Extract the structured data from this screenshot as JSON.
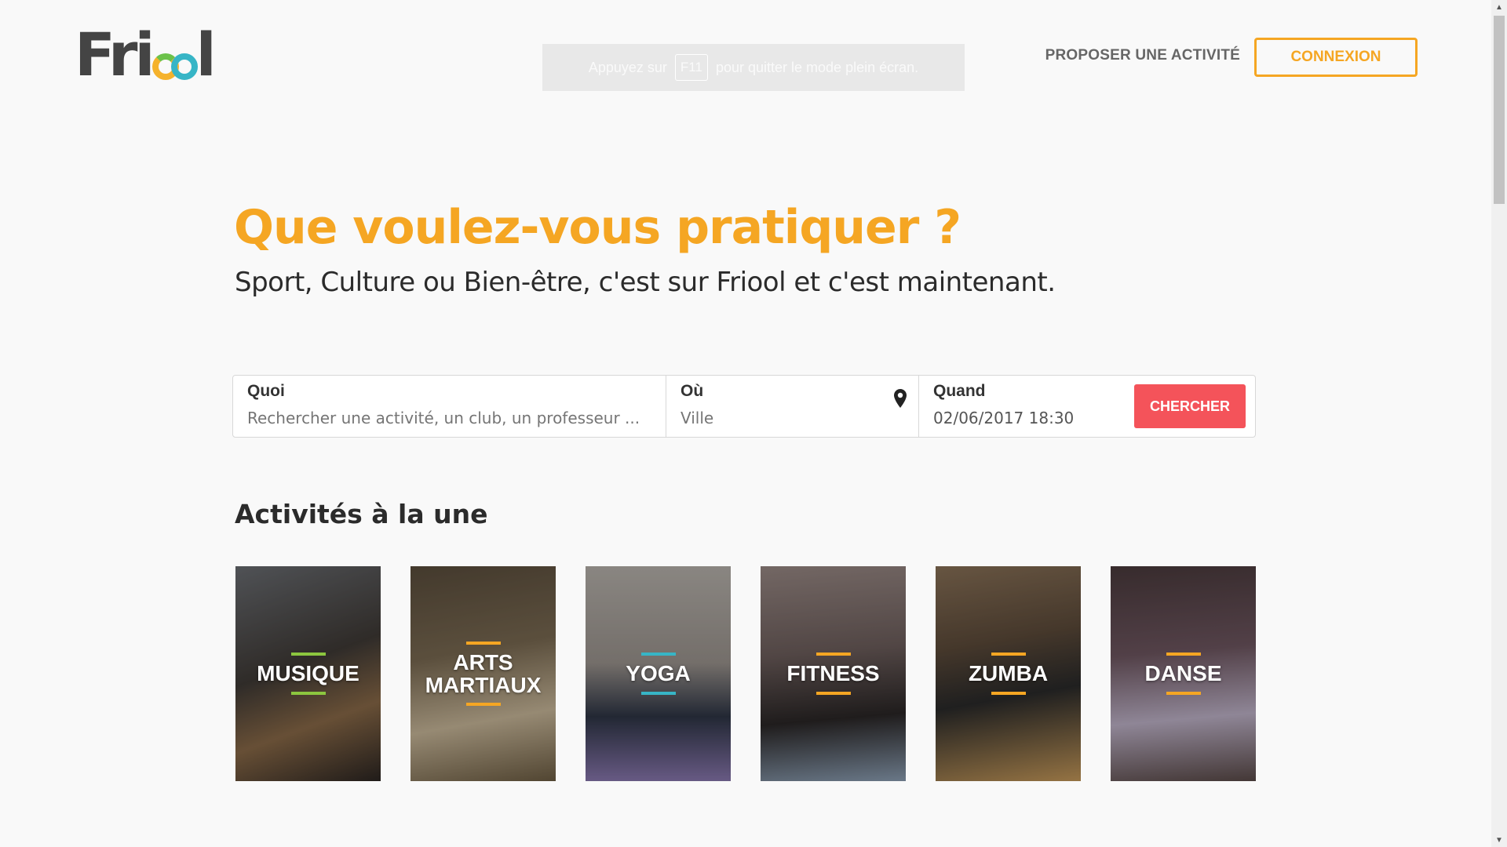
{
  "header": {
    "logo": "Friool",
    "fullscreen_notice": {
      "before": "Appuyez sur",
      "key": "F11",
      "after": "pour quitter le mode plein écran."
    },
    "propose_label": "PROPOSER UNE ACTIVITÉ",
    "connexion_label": "CONNEXION"
  },
  "hero": {
    "title": "Que voulez-vous pratiquer ?",
    "subtitle": "Sport, Culture ou Bien-être, c'est sur Friool et c'est maintenant."
  },
  "search": {
    "quoi": {
      "label": "Quoi",
      "placeholder": "Rechercher une activité, un club, un professeur ..."
    },
    "ou": {
      "label": "Où",
      "placeholder": "Ville"
    },
    "quand": {
      "label": "Quand",
      "value": "02/06/2017 18:30"
    },
    "button_label": "CHERCHER"
  },
  "featured": {
    "title": "Activités à la une",
    "cards": [
      {
        "label": "MUSIQUE",
        "accent": "#8cc63f"
      },
      {
        "label": "ARTS\nMARTIAUX",
        "accent": "#f5a623"
      },
      {
        "label": "YOGA",
        "accent": "#37b5c6"
      },
      {
        "label": "FITNESS",
        "accent": "#f5a623"
      },
      {
        "label": "ZUMBA",
        "accent": "#f5a623"
      },
      {
        "label": "DANSE",
        "accent": "#f5a623"
      }
    ]
  },
  "colors": {
    "brand_orange": "#f5a623",
    "search_button": "#f4535a"
  },
  "icons": {
    "location": "map-pin-icon"
  }
}
